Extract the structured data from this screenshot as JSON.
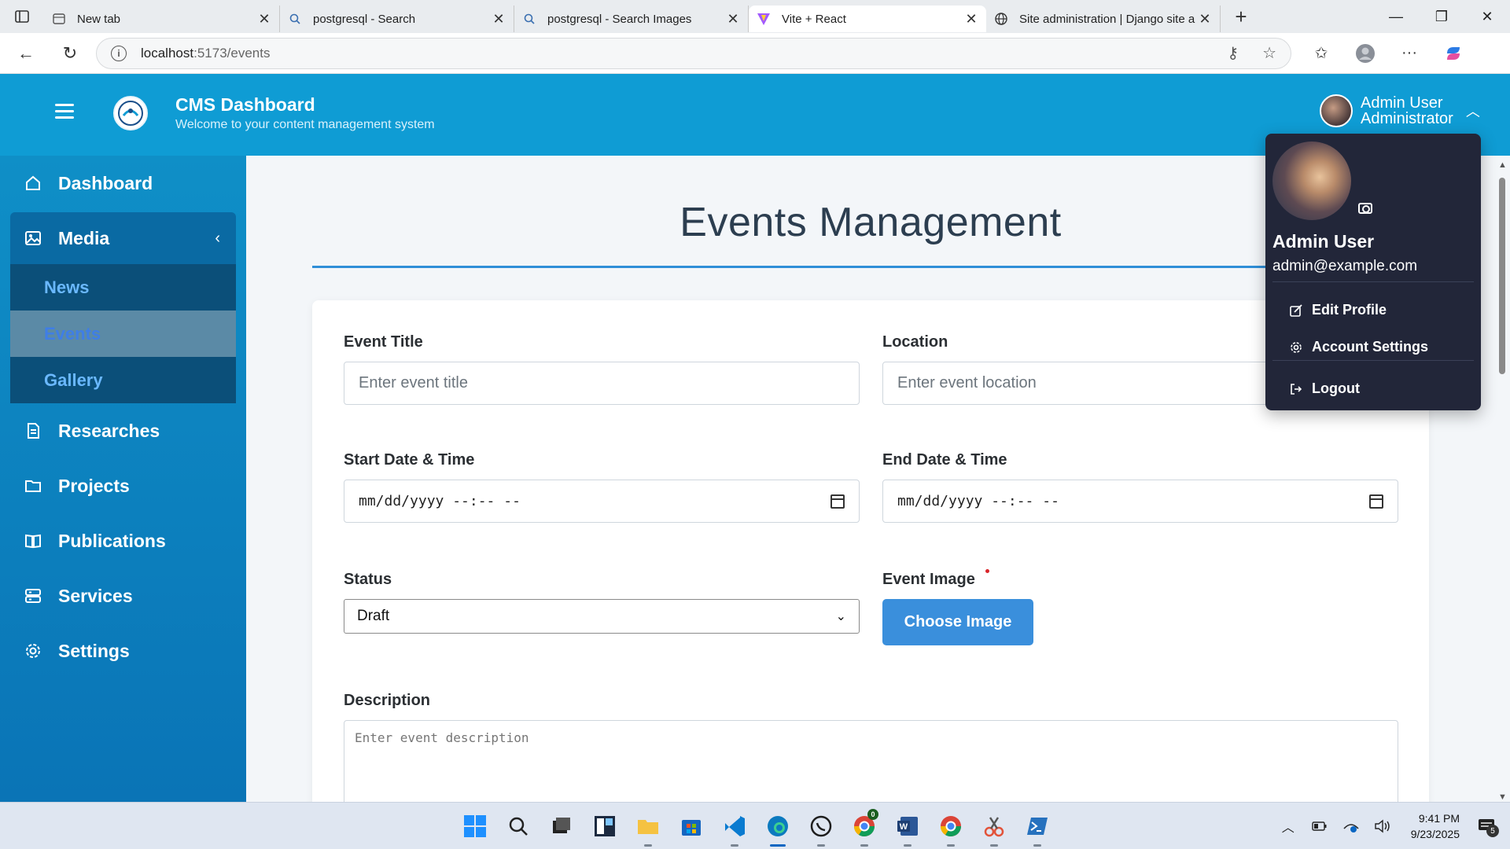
{
  "browser": {
    "tabs": [
      {
        "title": "New tab",
        "icon": "newtab-icon"
      },
      {
        "title": "postgresql - Search",
        "icon": "search-icon"
      },
      {
        "title": "postgresql - Search Images",
        "icon": "search-icon"
      },
      {
        "title": "Vite + React",
        "icon": "vite-icon",
        "active": true
      },
      {
        "title": "Site administration | Django site a",
        "icon": "globe-icon"
      }
    ],
    "url_host": "localhost",
    "url_path": ":5173/events"
  },
  "header": {
    "title": "CMS Dashboard",
    "subtitle": "Welcome to your content management system",
    "user_name": "Admin User",
    "user_role": "Administrator"
  },
  "sidebar": {
    "items": [
      {
        "label": "Dashboard",
        "icon": "home-icon"
      },
      {
        "label": "Media",
        "icon": "image-icon"
      },
      {
        "label": "Researches",
        "icon": "document-icon"
      },
      {
        "label": "Projects",
        "icon": "folder-icon"
      },
      {
        "label": "Publications",
        "icon": "book-icon"
      },
      {
        "label": "Services",
        "icon": "server-icon"
      },
      {
        "label": "Settings",
        "icon": "gear-icon"
      }
    ],
    "media_sub": [
      "News",
      "Events",
      "Gallery"
    ]
  },
  "page": {
    "title": "Events Management",
    "event_title_label": "Event Title",
    "event_title_placeholder": "Enter event title",
    "location_label": "Location",
    "location_placeholder": "Enter event location",
    "start_label": "Start Date & Time",
    "start_value": "mm/dd/yyyy --:-- --",
    "end_label": "End Date & Time",
    "end_value": "mm/dd/yyyy --:-- --",
    "status_label": "Status",
    "status_value": "Draft",
    "image_label": "Event Image",
    "choose_image": "Choose Image",
    "description_label": "Description",
    "description_placeholder": "Enter event description"
  },
  "dropdown": {
    "name": "Admin User",
    "email": "admin@example.com",
    "edit_profile": "Edit Profile",
    "account_settings": "Account Settings",
    "logout": "Logout"
  },
  "taskbar": {
    "time": "9:41 PM",
    "date": "9/23/2025",
    "notifications": "5",
    "chrome_badge": "0"
  },
  "colors": {
    "header": "#0f9cd4",
    "sidebar": "#0f8fc7",
    "accent": "#3a8fdc",
    "dropdown_bg": "#222639"
  }
}
